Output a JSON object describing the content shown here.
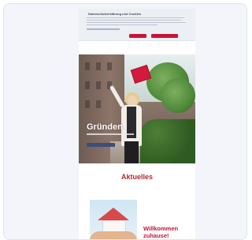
{
  "cookie_banner": {
    "title": "Datenschutzerklärung und Cookies",
    "accept_label": "",
    "settings_label": ""
  },
  "hero": {
    "title": "Gründen"
  },
  "news": {
    "section_title": "Aktuelles",
    "headline": "Willkommen zuhause!"
  },
  "colors": {
    "accent_red": "#c5163a",
    "section_red": "#b42a30",
    "background": "#f3f5fa"
  }
}
